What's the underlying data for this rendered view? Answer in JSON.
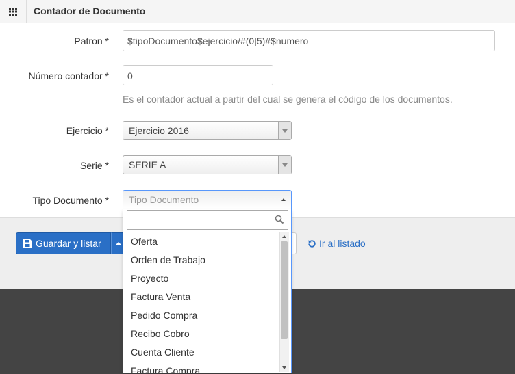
{
  "header": {
    "title": "Contador de Documento",
    "grid_icon": "grid-icon"
  },
  "form": {
    "patron": {
      "label": "Patron *",
      "value": "$tipoDocumento$ejercicio/#(0|5)#$numero"
    },
    "numero_contador": {
      "label": "Número contador *",
      "value": "0",
      "help": "Es el contador actual a partir del cual se genera el código de los documentos."
    },
    "ejercicio": {
      "label": "Ejercicio *",
      "selected": "Ejercicio 2016"
    },
    "serie": {
      "label": "Serie *",
      "selected": "SERIE A"
    },
    "tipo_documento": {
      "label": "Tipo Documento *",
      "placeholder": "Tipo Documento",
      "search_value": "",
      "options": [
        "Oferta",
        "Orden de Trabajo",
        "Proyecto",
        "Factura Venta",
        "Pedido Compra",
        "Recibo Cobro",
        "Cuenta Cliente",
        "Factura Compra"
      ]
    }
  },
  "actions": {
    "save_label": "Guardar y listar",
    "back_label": "Ir al listado"
  },
  "colors": {
    "primary": "#2a6fc6",
    "link": "#2a6fc6",
    "focus_border": "#5897fb",
    "dark_footer": "#444444"
  }
}
